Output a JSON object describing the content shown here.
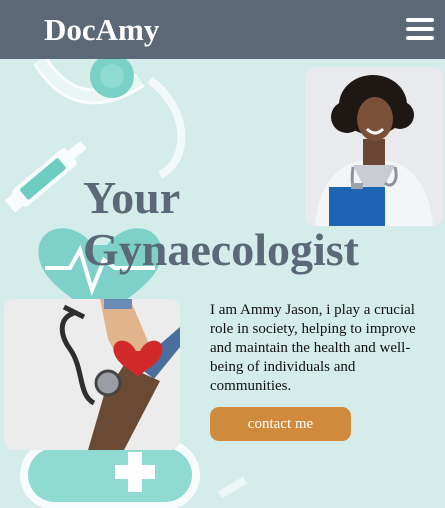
{
  "header": {
    "brand": "DocAmy",
    "menu_icon": "hamburger-menu-icon",
    "background_color": "#5a6878"
  },
  "hero": {
    "headline_line1": "Your",
    "headline_line2": "Gynaecologist",
    "headline_color": "#5a6878",
    "doctor_photo": "doctor-portrait-image",
    "hands_photo": "hands-heart-stethoscope-image",
    "bio": "I am Ammy Jason, i play a crucial role in society, helping to improve and maintain the health and well-being of individuals and communities.",
    "cta_label": "contact me",
    "cta_color": "#cf8b3b"
  },
  "background": {
    "color": "#d4ecea",
    "motif_color": "#76d2c8",
    "icons": [
      "stethoscope-icon",
      "syringe-icon",
      "heart-pulse-icon",
      "medical-cross-icon",
      "pill-icon"
    ]
  }
}
